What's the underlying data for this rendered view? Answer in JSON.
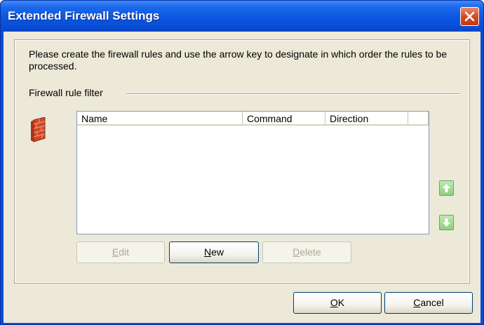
{
  "window": {
    "title": "Extended Firewall Settings"
  },
  "description": "Please create the firewall rules and use the arrow key to designate in which order the rules to be processed.",
  "filter_label": "Firewall rule filter",
  "table": {
    "columns": [
      "Name",
      "Command",
      "Direction"
    ],
    "rows": []
  },
  "buttons": {
    "edit": {
      "mnemonic": "E",
      "rest": "dit",
      "enabled": false
    },
    "new": {
      "mnemonic": "N",
      "rest": "ew",
      "enabled": true
    },
    "delete": {
      "mnemonic": "D",
      "rest": "elete",
      "enabled": false
    },
    "ok": {
      "mnemonic": "O",
      "rest": "K"
    },
    "cancel": {
      "mnemonic": "C",
      "rest": "ancel"
    }
  },
  "icons": {
    "firewall": "brick-wall-icon",
    "up": "arrow-up-icon",
    "down": "arrow-down-icon",
    "close": "close-icon"
  },
  "colors": {
    "titlebar": "#0b56e0",
    "close": "#d4471b",
    "arrow_button": "#8fd07c",
    "brick": "#d2462a"
  }
}
